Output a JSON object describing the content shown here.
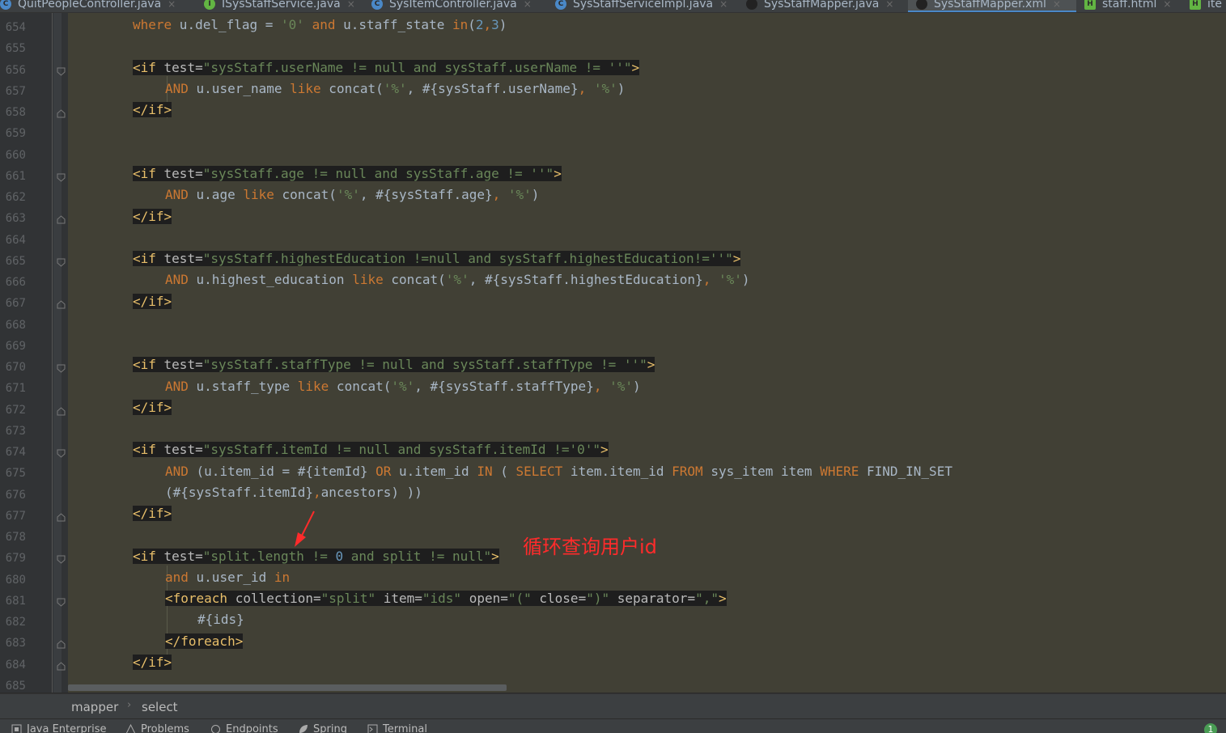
{
  "tabs": [
    {
      "label": "QuitPeopleController.java",
      "icon": "java-class-icon",
      "color": "#4a88c7",
      "active": false
    },
    {
      "label": "ISysStaffService.java",
      "icon": "java-interface-icon",
      "color": "#62b543",
      "active": false
    },
    {
      "label": "SysItemController.java",
      "icon": "java-class-icon",
      "color": "#4a88c7",
      "active": false
    },
    {
      "label": "SysStaffServiceImpl.java",
      "icon": "java-class-icon",
      "color": "#4a88c7",
      "active": false
    },
    {
      "label": "SysStaffMapper.java",
      "icon": "mybatis-bird-icon",
      "color": "#222222",
      "active": false
    },
    {
      "label": "SysStaffMapper.xml",
      "icon": "mybatis-bird-icon",
      "color": "#222222",
      "active": true
    },
    {
      "label": "staff.html",
      "icon": "html-file-icon",
      "color": "#62b543",
      "active": false
    },
    {
      "label": "ite",
      "icon": "html-file-icon",
      "color": "#62b543",
      "active": false
    }
  ],
  "line_numbers": [
    "654",
    "655",
    "656",
    "657",
    "658",
    "659",
    "660",
    "661",
    "662",
    "663",
    "664",
    "665",
    "666",
    "667",
    "668",
    "669",
    "670",
    "671",
    "672",
    "673",
    "674",
    "675",
    "676",
    "677",
    "678",
    "679",
    "680",
    "681",
    "682",
    "683",
    "684",
    "685"
  ],
  "code": {
    "l654": [
      "where",
      " u.del_flag = ",
      "'0'",
      " and",
      " u.staff_state ",
      "in",
      "(",
      "2",
      ",",
      "3",
      ")"
    ],
    "l656": [
      "<if",
      " test=",
      "\"sysStaff.userName != null and sysStaff.userName != ''\"",
      ">"
    ],
    "l657": [
      "AND",
      " u.user_name ",
      "like",
      " concat(",
      "'%'",
      ", #{sysStaff.userName}",
      ", ",
      "'%'",
      ")"
    ],
    "l658": [
      "</if>"
    ],
    "l661": [
      "<if",
      " test=",
      "\"sysStaff.age != null and sysStaff.age != ''\"",
      ">"
    ],
    "l662": [
      "AND",
      " u.age ",
      "like",
      " concat(",
      "'%'",
      ", #{sysStaff.age}",
      ", ",
      "'%'",
      ")"
    ],
    "l663": [
      "</if>"
    ],
    "l665": [
      "<if",
      " test=",
      "\"sysStaff.highestEducation !=null and sysStaff.highestEducation!=''\"",
      ">"
    ],
    "l666": [
      "AND",
      " u.highest_education ",
      "like",
      " concat(",
      "'%'",
      ", #{sysStaff.highestEducation}",
      ", ",
      "'%'",
      ")"
    ],
    "l667": [
      "</if>"
    ],
    "l670": [
      "<if",
      " test=",
      "\"sysStaff.staffType != null and sysStaff.staffType != ''\"",
      ">"
    ],
    "l671": [
      "AND",
      " u.staff_type ",
      "like",
      " concat(",
      "'%'",
      ", #{sysStaff.staffType}",
      ", ",
      "'%'",
      ")"
    ],
    "l672": [
      "</if>"
    ],
    "l674": [
      "<if",
      " test=",
      "\"sysStaff.itemId != null and sysStaff.itemId !='0'\"",
      ">"
    ],
    "l675": [
      "AND",
      " (u.item_id = #{itemId} ",
      "OR",
      " u.item_id ",
      "IN",
      " ( ",
      "SELECT",
      " item.item_id ",
      "FROM",
      " sys_item item ",
      "WHERE",
      " FIND_IN_SET"
    ],
    "l676": [
      "(#{sysStaff.itemId}",
      ",",
      "ancestors) ))"
    ],
    "l677": [
      "</if>"
    ],
    "l679": [
      "<if",
      " test=",
      "\"split.length != ",
      "0",
      " and split != null\"",
      ">"
    ],
    "l680": [
      "and",
      " u.user_id ",
      "in"
    ],
    "l681": [
      "<foreach",
      " collection=",
      "\"split\"",
      " item=",
      "\"ids\"",
      " open=",
      "\"(\"",
      " close=",
      "\")\"",
      " separator=",
      "\",\"",
      ">"
    ],
    "l682": [
      "#{ids}"
    ],
    "l683": [
      "</foreach>"
    ],
    "l684": [
      "</if>"
    ]
  },
  "annotation": "循环查询用户id",
  "breadcrumb": [
    "mapper",
    "select"
  ],
  "toolwindows": [
    {
      "label": "Java Enterprise",
      "icon": "java-enterprise-icon"
    },
    {
      "label": "Problems",
      "icon": "warning-icon"
    },
    {
      "label": "Endpoints",
      "icon": "endpoints-icon"
    },
    {
      "label": "Spring",
      "icon": "spring-leaf-icon"
    },
    {
      "label": "Terminal",
      "icon": "terminal-icon"
    }
  ],
  "notification_count": "1",
  "colors": {
    "editor_bg": "#414035",
    "keyword": "#cc7832",
    "string": "#6a8759",
    "number": "#6897bb",
    "tag": "#e8bf6a",
    "annotation": "#ff2b2b"
  }
}
